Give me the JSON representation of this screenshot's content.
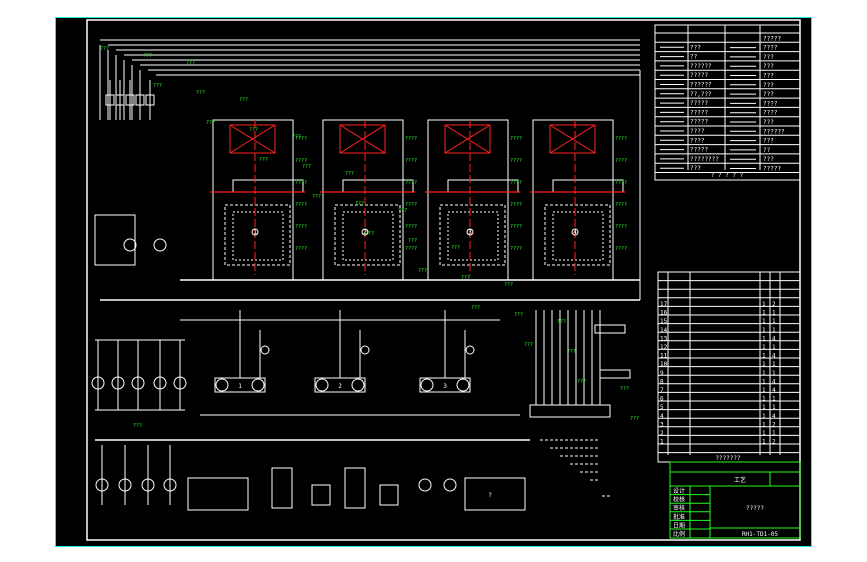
{
  "colors": {
    "background": "#000000",
    "frame": "#ffffff",
    "border": "#22dddd",
    "annotation": "#22ff22",
    "centerline": "#ff2222"
  },
  "legend": {
    "rows": [
      "???",
      "??",
      "??????",
      "?????",
      "??????",
      "??,???",
      "?????",
      "?????",
      "?????",
      "????",
      "????",
      "?????",
      "????????",
      "???"
    ],
    "right_rows": [
      "?????",
      "????",
      "???",
      "???",
      "???",
      "???",
      "???",
      "????",
      "????",
      "???",
      "??????",
      "???",
      "??",
      "???",
      "?????"
    ],
    "footer": "? ? ? ? ?"
  },
  "boilers": {
    "labels": [
      "1",
      "2",
      "3",
      "4"
    ]
  },
  "exchangers": {
    "labels": [
      "1",
      "2",
      "3"
    ]
  },
  "parts_list": {
    "rows": [
      {
        "no": "17",
        "qty": "1",
        "unit": "2"
      },
      {
        "no": "16",
        "qty": "1",
        "unit": "1"
      },
      {
        "no": "15",
        "qty": "1",
        "unit": "1"
      },
      {
        "no": "14",
        "qty": "1",
        "unit": "1"
      },
      {
        "no": "13",
        "qty": "1",
        "unit": "4"
      },
      {
        "no": "12",
        "qty": "1",
        "unit": "1"
      },
      {
        "no": "11",
        "qty": "1",
        "unit": "4"
      },
      {
        "no": "10",
        "qty": "1",
        "unit": "1"
      },
      {
        "no": "9",
        "qty": "1",
        "unit": "1"
      },
      {
        "no": "8",
        "qty": "1",
        "unit": "4"
      },
      {
        "no": "7",
        "qty": "1",
        "unit": "4"
      },
      {
        "no": "6",
        "qty": "1",
        "unit": "1"
      },
      {
        "no": "5",
        "qty": "1",
        "unit": "1"
      },
      {
        "no": "4",
        "qty": "1",
        "unit": "4"
      },
      {
        "no": "3",
        "qty": "1",
        "unit": "2"
      },
      {
        "no": "2",
        "qty": "1",
        "unit": "1"
      },
      {
        "no": "1",
        "qty": "1",
        "unit": "2"
      }
    ],
    "footer": "???????"
  },
  "title_block": {
    "stage": "工艺",
    "drawing_title": "?????",
    "drawing_number": "RH1-TD1-05",
    "roles": [
      "设计",
      "校核",
      "审核",
      "批准",
      "日期",
      "比例"
    ]
  }
}
